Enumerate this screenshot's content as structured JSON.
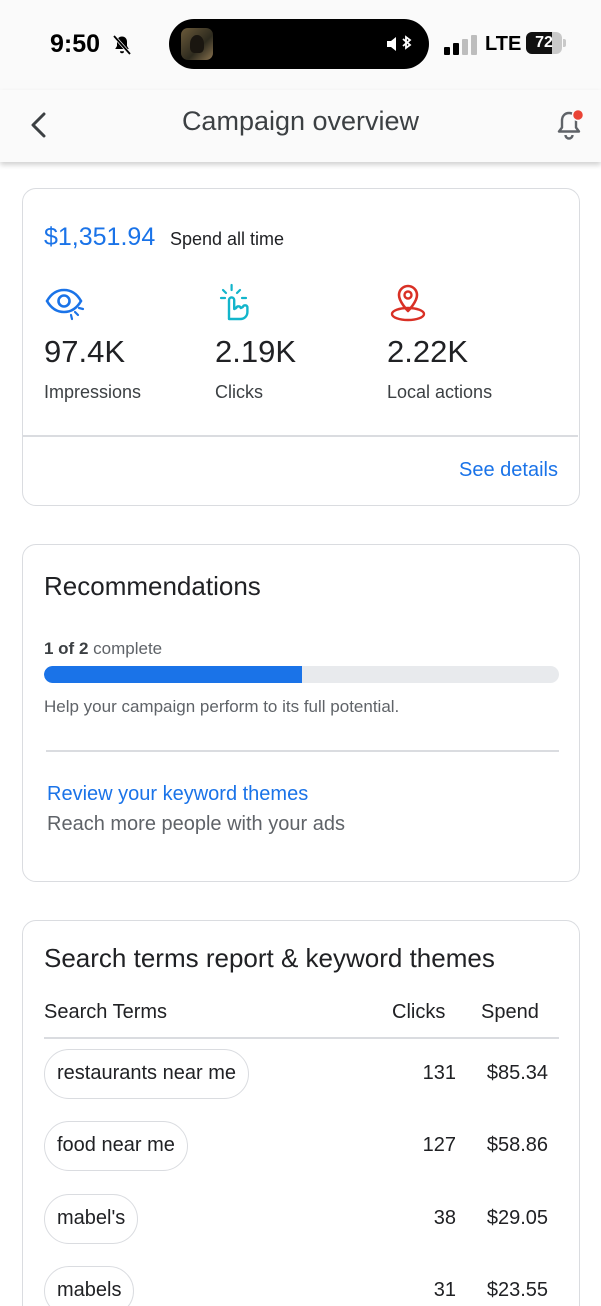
{
  "status_bar": {
    "time": "9:50",
    "network": "LTE",
    "battery": "72",
    "battery_level": 0.72
  },
  "app_bar": {
    "title": "Campaign overview",
    "back_icon": "chevron-left-icon",
    "alert_icon": "notification-bell-icon",
    "alert_dot_color": "#ea4335"
  },
  "overview": {
    "spend_amount": "$1,351.94",
    "spend_label": "Spend all time",
    "metrics": [
      {
        "icon": "eye-icon",
        "value": "97.4K",
        "label": "Impressions",
        "color": "#1a73e8"
      },
      {
        "icon": "tap-icon",
        "value": "2.19K",
        "label": "Clicks",
        "color": "#12b5cb"
      },
      {
        "icon": "location-pin-icon",
        "value": "2.22K",
        "label": "Local actions",
        "color": "#d93025"
      }
    ],
    "see_details": "See details"
  },
  "recommendations": {
    "title": "Recommendations",
    "progress_done": "1 of 2",
    "progress_suffix": "complete",
    "progress_fraction": 0.5,
    "help_text": "Help your campaign perform to its full potential.",
    "item_title": "Review your keyword themes",
    "item_subtitle": "Reach more people with your ads"
  },
  "search_terms": {
    "title": "Search terms report & keyword themes",
    "columns": [
      "Search Terms",
      "Clicks",
      "Spend"
    ],
    "rows": [
      {
        "term": "restaurants near me",
        "clicks": "131",
        "spend": "$85.34"
      },
      {
        "term": "food near me",
        "clicks": "127",
        "spend": "$58.86"
      },
      {
        "term": "mabel's",
        "clicks": "38",
        "spend": "$29.05"
      },
      {
        "term": "mabels",
        "clicks": "31",
        "spend": "$23.55"
      }
    ]
  },
  "colors": {
    "accent": "#1a73e8",
    "divider": "#dadce0",
    "track": "#e8eaed"
  }
}
